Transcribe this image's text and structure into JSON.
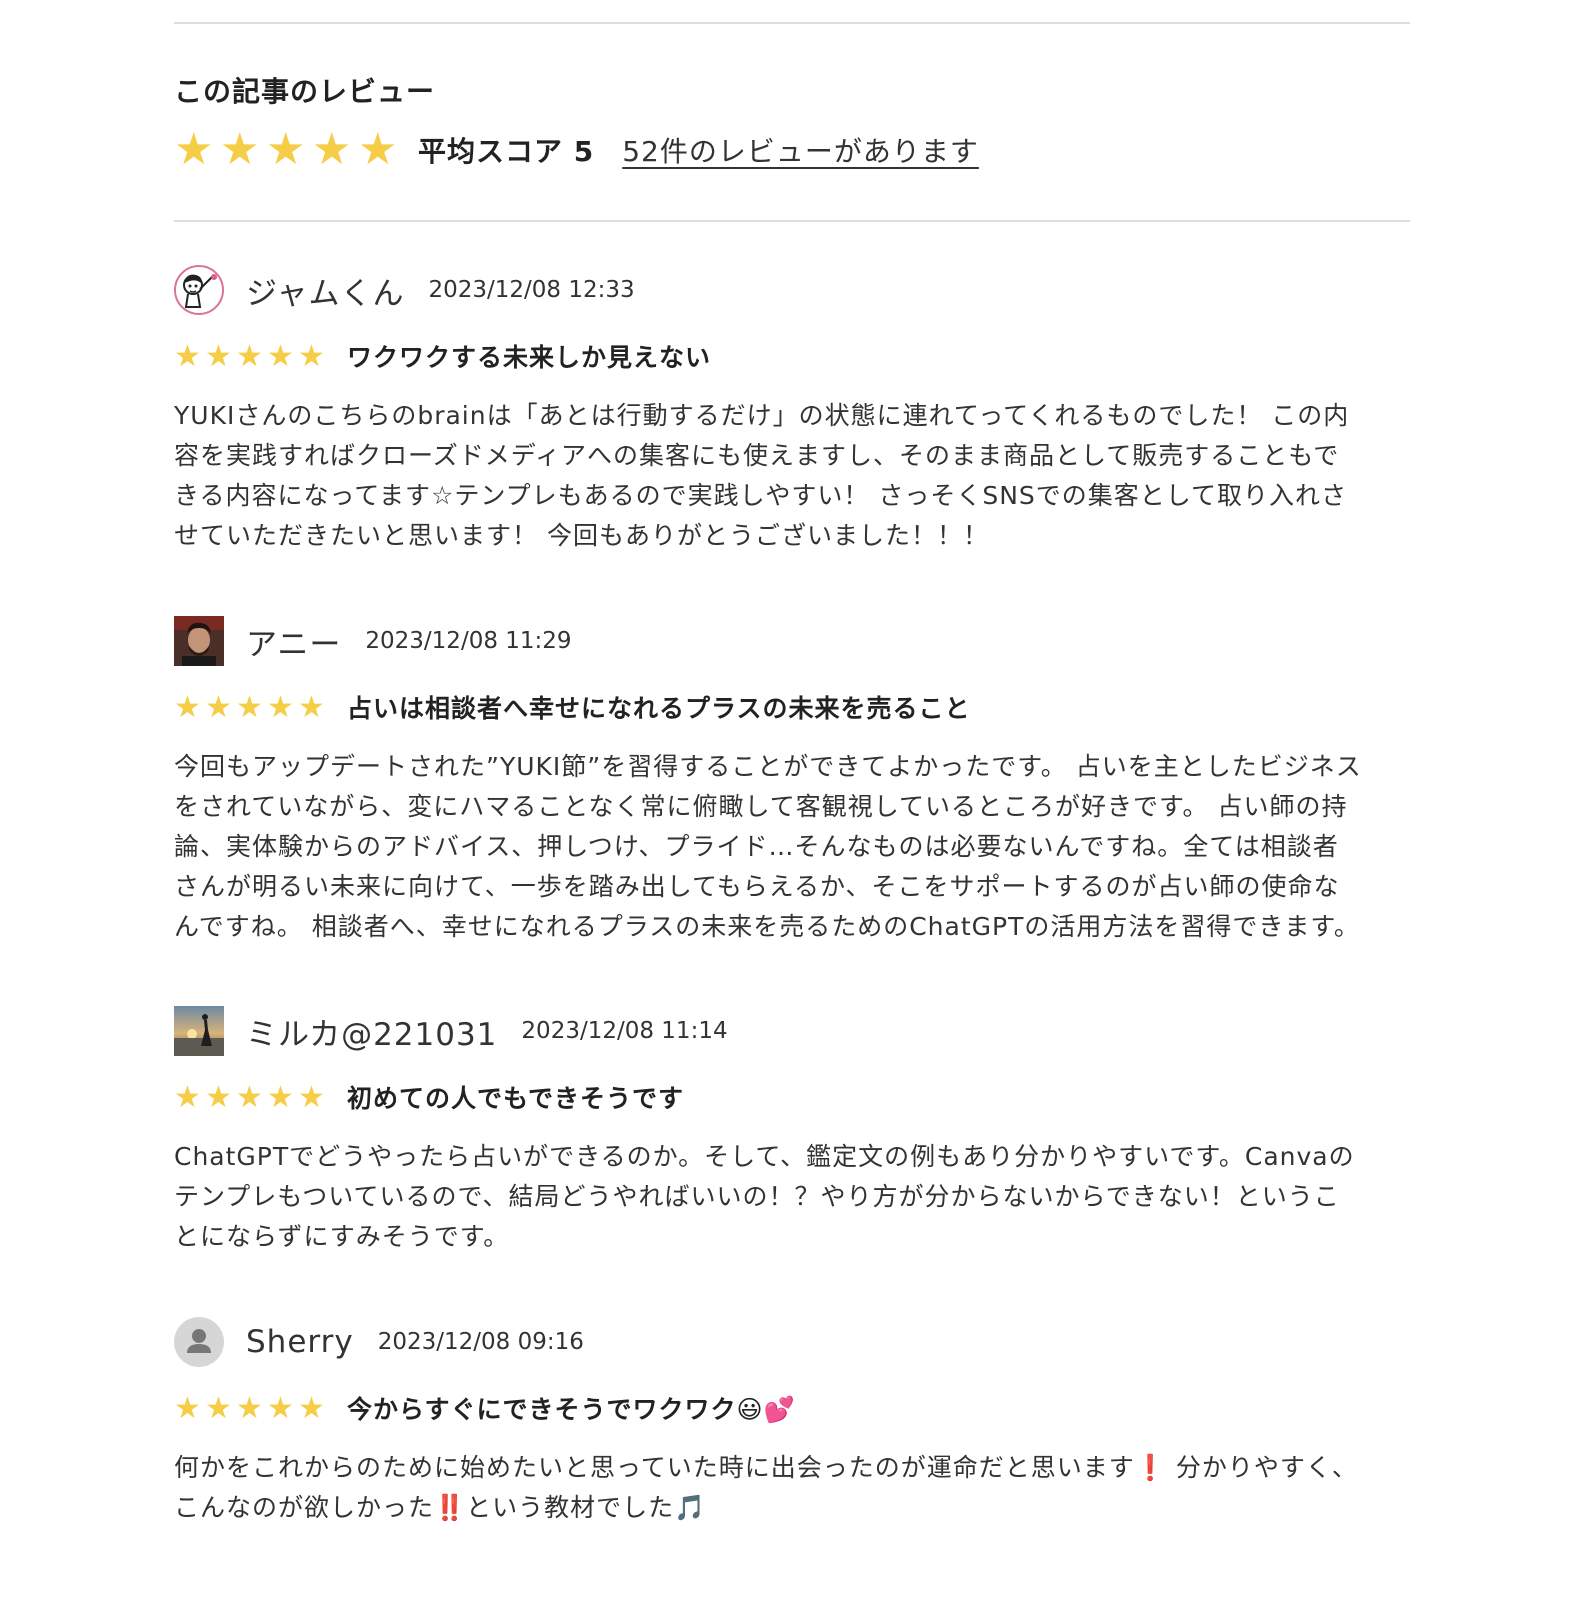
{
  "summary": {
    "title": "この記事のレビュー",
    "stars": 5,
    "average_label": "平均スコア 5",
    "count_link": "52件のレビューがあります"
  },
  "colors": {
    "star": "#f5cd47",
    "rule": "#dedede",
    "text": "#333333"
  },
  "reviews": [
    {
      "avatar": "cartoon-avatar",
      "name": "ジャムくん",
      "date": "2023/12/08 12:33",
      "stars": 5,
      "title": "ワクワクする未来しか見えない",
      "body": "YUKIさんのこちらのbrainは「あとは行動するだけ」の状態に連れてってくれるものでした！ この内\n容を実践すればクローズドメディアへの集客にも使えますし、そのまま商品として販売することもで\nきる内容になってます☆テンプレもあるので実践しやすい！ さっそくSNSでの集客として取り入れさ\nせていただきたいと思います！ 今回もありがとうございました！！！"
    },
    {
      "avatar": "photo-avatar",
      "name": "アニー",
      "date": "2023/12/08 11:29",
      "stars": 5,
      "title": "占いは相談者へ幸せになれるプラスの未来を売ること",
      "body": "今回もアップデートされた”YUKI節”を習得することができてよかったです。 占いを主としたビジネス\nをされていながら、変にハマることなく常に俯瞰して客観視しているところが好きです。 占い師の持\n論、実体験からのアドバイス、押しつけ、プライド…そんなものは必要ないんですね。全ては相談者\nさんが明るい未来に向けて、一歩を踏み出してもらえるか、そこをサポートするのが占い師の使命な\nんですね。 相談者へ、幸せになれるプラスの未来を売るためのChatGPTの活用方法を習得できます。"
    },
    {
      "avatar": "sunset-avatar",
      "name": "ミルカ@221031",
      "date": "2023/12/08 11:14",
      "stars": 5,
      "title": "初めての人でもできそうです",
      "body": "ChatGPTでどうやったら占いができるのか。そして、鑑定文の例もあり分かりやすいです。Canvaの\nテンプレもついているので、結局どうやればいいの！？やり方が分からないからできない！というこ\nとにならずにすみそうです。"
    },
    {
      "avatar": "default-user-avatar",
      "name": "Sherry",
      "date": "2023/12/08 09:16",
      "stars": 5,
      "title": "今からすぐにできそうでワクワク😃💕",
      "body": "何かをこれからのために始めたいと思っていた時に出会ったのが運命だと思います❗ 分かりやすく、\nこんなのが欲しかった‼️という教材でした🎵"
    }
  ]
}
